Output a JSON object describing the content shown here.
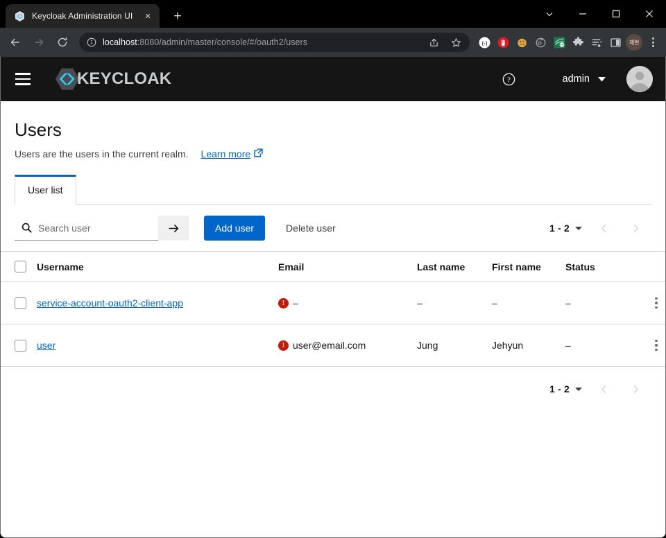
{
  "browser": {
    "tab": {
      "title": "Keycloak Administration UI",
      "favicon": "keycloak-icon",
      "close": "×",
      "new_tab": "+"
    },
    "window_controls": {
      "list_all_tabs": "chevron-down-icon",
      "minimize": "minimize-icon",
      "maximize": "maximize-icon",
      "close": "close-icon"
    },
    "nav": {
      "back": "←",
      "forward": "→",
      "reload": "⟳"
    },
    "omnibox": {
      "info_icon": "site-info-icon",
      "url_host": "localhost",
      "url_rest": ":8080/admin/master/console/#/oauth2/users",
      "share_icon": "share-icon",
      "bookmark_icon": "star-icon"
    },
    "extensions": [
      {
        "name": "extension-brackets",
        "glyph": "⟨·⟩"
      },
      {
        "name": "extension-adblock",
        "glyph": "✋"
      },
      {
        "name": "extension-cookie",
        "glyph": "🍪"
      },
      {
        "name": "extension-sync",
        "glyph": "⟳"
      },
      {
        "name": "extension-korean-translate",
        "glyph": "한"
      },
      {
        "name": "extension-puzzle",
        "glyph": "🧩"
      },
      {
        "name": "extension-playlist",
        "glyph": "☰"
      },
      {
        "name": "extension-sidepanel",
        "glyph": "▣"
      }
    ],
    "profile_avatar": "제현",
    "menu": "chrome-menu-icon"
  },
  "masthead": {
    "nav_toggle": "hamburger-icon",
    "brand_text": "KEYCLOAK",
    "help_icon": "help-icon",
    "username": "admin",
    "avatar": "user-avatar-icon"
  },
  "page": {
    "title": "Users",
    "description": "Users are the users in the current realm.",
    "learn_more": "Learn more",
    "external_link_icon": "external-link-icon",
    "tabs": [
      {
        "label": "User list",
        "active": true
      }
    ]
  },
  "toolbar": {
    "search_placeholder": "Search user",
    "search_value": "",
    "search_icon": "search-icon",
    "search_submit_icon": "arrow-right-icon",
    "add_user_label": "Add user",
    "delete_user_label": "Delete user",
    "primary_color": "#0066cc"
  },
  "pagination": {
    "range": "1 - 2",
    "caret_icon": "caret-down-icon",
    "prev_icon": "chevron-left-icon",
    "next_icon": "chevron-right-icon"
  },
  "table": {
    "select_all_label": "select-all-checkbox",
    "columns": [
      "Username",
      "Email",
      "Last name",
      "First name",
      "Status"
    ],
    "rows": [
      {
        "username": "service-account-oauth2-client-app",
        "email": "–",
        "email_warning": true,
        "last_name": "–",
        "first_name": "–",
        "status": "–"
      },
      {
        "username": "user",
        "email": "user@email.com",
        "email_warning": true,
        "last_name": "Jung",
        "first_name": "Jehyun",
        "status": "–"
      }
    ],
    "warning_icon": "exclamation-circle-icon",
    "warning_color": "#c9190b",
    "kebab_icon": "kebab-menu-icon"
  }
}
